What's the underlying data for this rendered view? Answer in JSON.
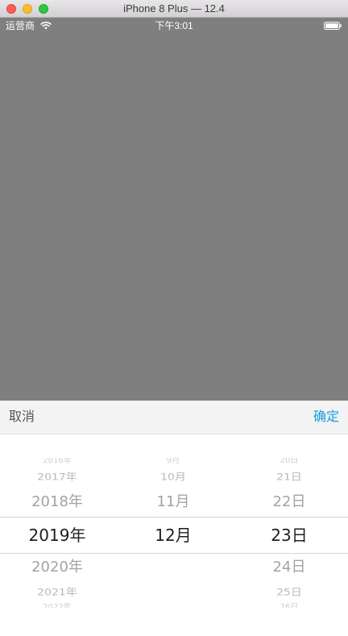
{
  "window": {
    "title": "iPhone 8 Plus — 12.4",
    "controls": [
      "close",
      "minimize",
      "zoom"
    ]
  },
  "status_bar": {
    "carrier": "运营商",
    "wifi_icon": "wifi-icon",
    "time": "下午3:01",
    "battery_icon": "battery-icon"
  },
  "toolbar": {
    "cancel_label": "取消",
    "confirm_label": "确定",
    "confirm_color": "#1a9be0",
    "background_color": "#f3f3f3"
  },
  "picker": {
    "year": {
      "items": [
        "2016年",
        "2017年",
        "2018年",
        "2019年",
        "2020年",
        "2021年",
        "2022年"
      ],
      "selected": "2019年"
    },
    "month": {
      "items": [
        "9月",
        "10月",
        "11月",
        "12月"
      ],
      "selected": "12月"
    },
    "day": {
      "items": [
        "20日",
        "21日",
        "22日",
        "23日",
        "24日",
        "25日",
        "26日"
      ],
      "selected": "23日"
    }
  },
  "overlay_color": "#7f7f7f"
}
